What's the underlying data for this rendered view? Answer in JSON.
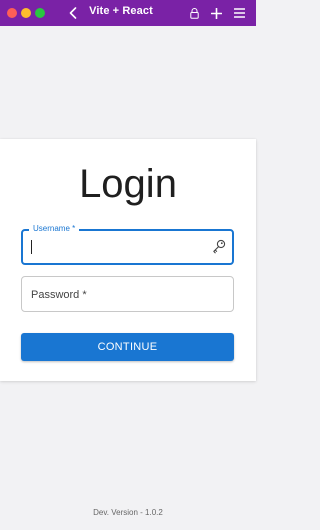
{
  "window": {
    "title": "Vite + React",
    "accent_color": "#7a22a6"
  },
  "toolbar": {
    "icons": [
      "back-chevron-icon",
      "lock-icon",
      "plus-icon",
      "menu-icon"
    ]
  },
  "login": {
    "heading": "Login",
    "username": {
      "label": "Username *",
      "value": ""
    },
    "password": {
      "label": "Password *",
      "value": ""
    },
    "continue_label": "CONTINUE",
    "primary_color": "#1976d2"
  },
  "footer": {
    "version_text": "Dev. Version - 1.0.2"
  }
}
